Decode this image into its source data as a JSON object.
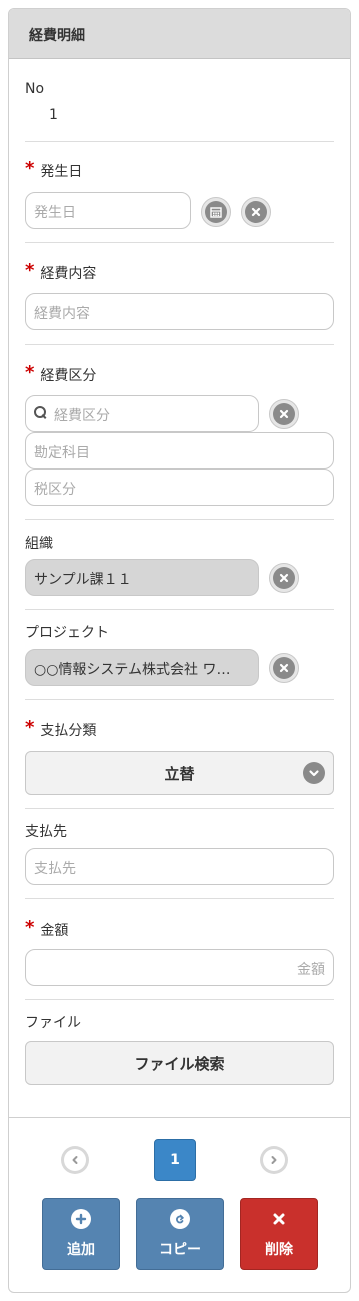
{
  "header": {
    "title": "経費明細"
  },
  "no": {
    "label": "No",
    "value": "1"
  },
  "occurrence_date": {
    "label": "発生日",
    "placeholder": "発生日"
  },
  "expense_content": {
    "label": "経費内容",
    "placeholder": "経費内容"
  },
  "expense_category": {
    "label": "経費区分",
    "placeholder": "経費区分",
    "account_placeholder": "勘定科目",
    "tax_placeholder": "税区分"
  },
  "organization": {
    "label": "組織",
    "value": "サンプル課１１"
  },
  "project": {
    "label": "プロジェクト",
    "value": "○○情報システム株式会社 ワ…"
  },
  "payment_type": {
    "label": "支払分類",
    "selected": "立替"
  },
  "payee": {
    "label": "支払先",
    "placeholder": "支払先"
  },
  "amount": {
    "label": "金額",
    "placeholder": "金額"
  },
  "file": {
    "label": "ファイル",
    "button": "ファイル検索"
  },
  "pagination": {
    "current": "1"
  },
  "actions": {
    "add": "追加",
    "copy": "コピー",
    "delete": "削除"
  },
  "colors": {
    "required": "#cc0000",
    "primary_blue": "#5584b1",
    "page_blue": "#3b87c8",
    "danger_red": "#c9302c"
  },
  "icons": {
    "calendar": "calendar-icon",
    "clear": "close-circle-icon",
    "search": "search-icon",
    "chevron": "chevron-down-icon",
    "prev": "chevron-left-icon",
    "next": "chevron-right-icon",
    "add": "plus-icon",
    "copy": "redo-icon",
    "delete": "x-icon"
  },
  "required_mark": "*"
}
